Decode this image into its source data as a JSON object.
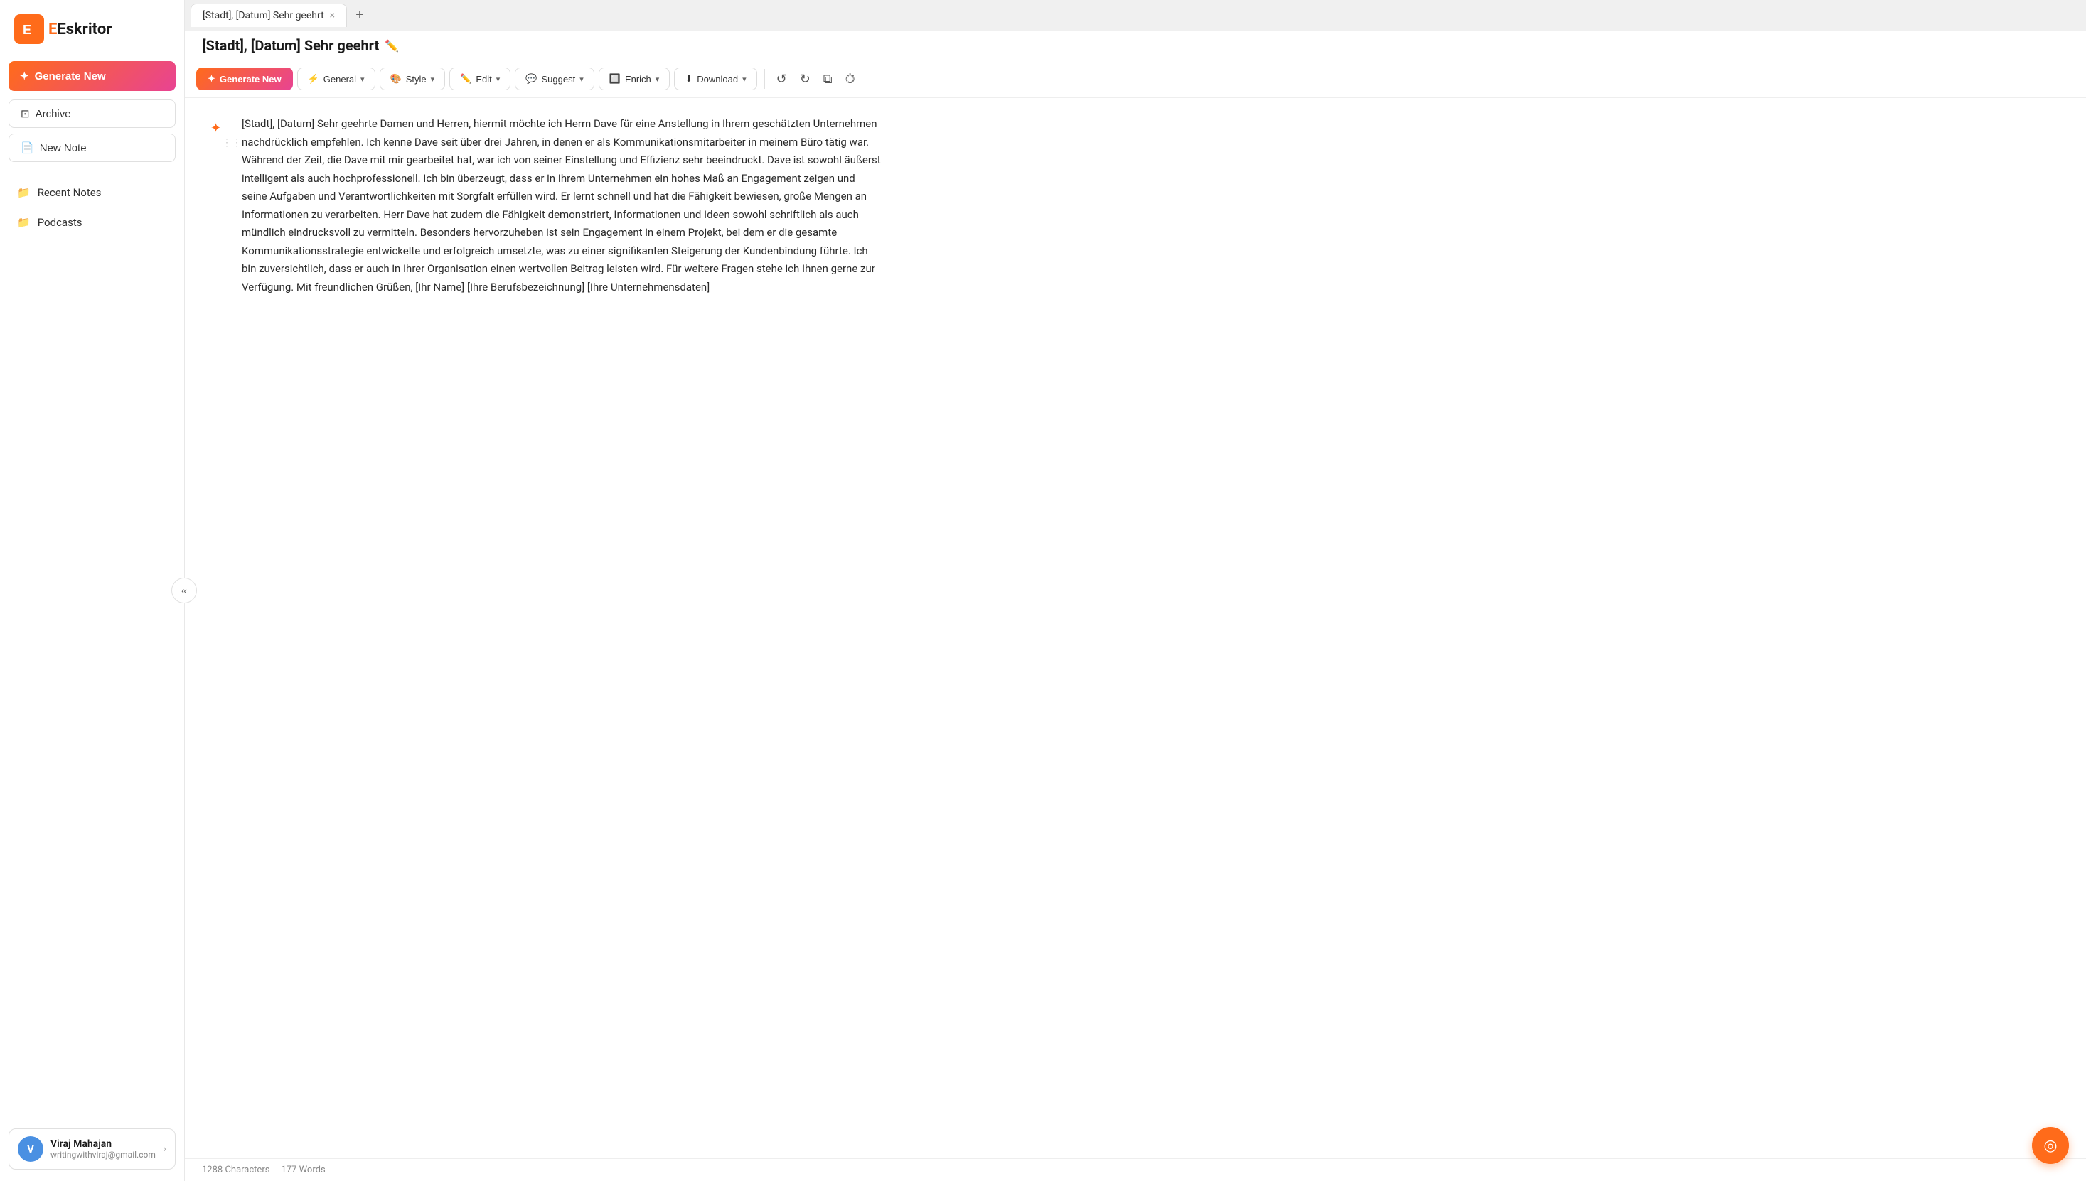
{
  "app": {
    "name": "Eskritor",
    "logo_letter": "E"
  },
  "sidebar": {
    "generate_new_label": "Generate New",
    "archive_label": "Archive",
    "new_note_label": "New Note",
    "nav_items": [
      {
        "id": "recent-notes",
        "label": "Recent Notes",
        "icon": "folder"
      },
      {
        "id": "podcasts",
        "label": "Podcasts",
        "icon": "folder"
      }
    ],
    "user": {
      "name": "Viraj Mahajan",
      "email": "writingwithviraj@gmail.com",
      "avatar_letter": "V"
    }
  },
  "tab": {
    "title": "[Stadt], [Datum] Sehr geehrt",
    "close_label": "×",
    "add_label": "+"
  },
  "toolbar": {
    "generate_new_label": "Generate New",
    "general_label": "General",
    "style_label": "Style",
    "edit_label": "Edit",
    "suggest_label": "Suggest",
    "enrich_label": "Enrich",
    "download_label": "Download",
    "undo_label": "↺",
    "redo_label": "↻",
    "copy_label": "⧉",
    "history_label": "⏱"
  },
  "document": {
    "title": "[Stadt], [Datum] Sehr geehrt",
    "content": "[Stadt], [Datum] Sehr geehrte Damen und Herren, hiermit möchte ich Herrn Dave für eine Anstellung in Ihrem geschätzten Unternehmen nachdrücklich empfehlen. Ich kenne Dave seit über drei Jahren, in denen er als Kommunikationsmitarbeiter in meinem Büro tätig war. Während der Zeit, die Dave mit mir gearbeitet hat, war ich von seiner Einstellung und Effizienz sehr beeindruckt. Dave ist sowohl äußerst intelligent als auch hochprofessionell. Ich bin überzeugt, dass er in Ihrem Unternehmen ein hohes Maß an Engagement zeigen und seine Aufgaben und Verantwortlichkeiten mit Sorgfalt erfüllen wird. Er lernt schnell und hat die Fähigkeit bewiesen, große Mengen an Informationen zu verarbeiten. Herr Dave hat zudem die Fähigkeit demonstriert, Informationen und Ideen sowohl schriftlich als auch mündlich eindrucksvoll zu vermitteln. Besonders hervorzuheben ist sein Engagement in einem Projekt, bei dem er die gesamte Kommunikationsstrategie entwickelte und erfolgreich umsetzte, was zu einer signifikanten Steigerung der Kundenbindung führte. Ich bin zuversichtlich, dass er auch in Ihrer Organisation einen wertvollen Beitrag leisten wird. Für weitere Fragen stehe ich Ihnen gerne zur Verfügung. Mit freundlichen Grüßen, [Ihr Name] [Ihre Berufsbezeichnung] [Ihre Unternehmensdaten]"
  },
  "status_bar": {
    "characters_label": "1288 Characters",
    "words_label": "177 Words"
  },
  "collapse_button_label": "«"
}
